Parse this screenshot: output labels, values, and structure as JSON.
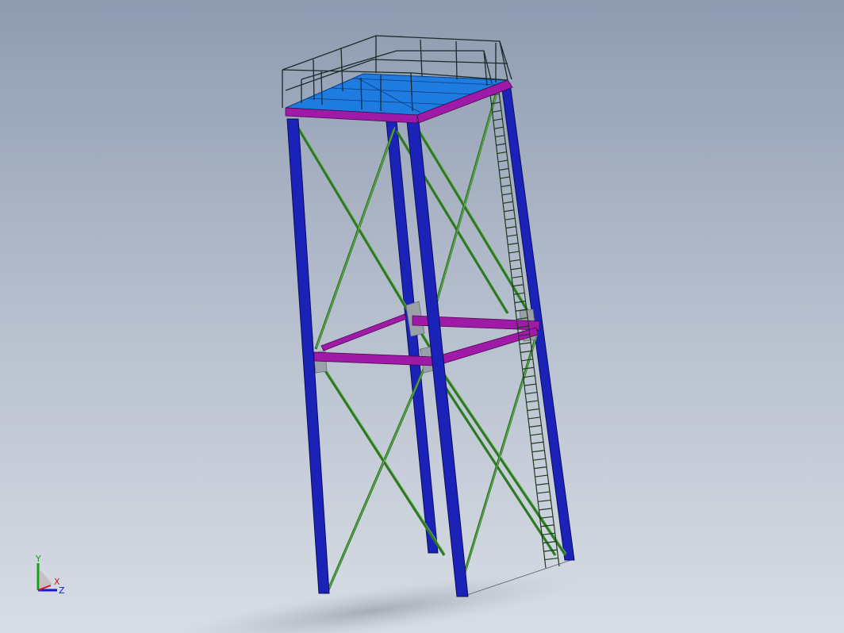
{
  "viewport": {
    "background_top": "#8e9bb0",
    "background_bottom": "#d8dde5"
  },
  "model": {
    "colors": {
      "column": "#1a22b8",
      "column_edge": "#0a0f5a",
      "beam": "#a01aa8",
      "bracing": "#2e7a22",
      "deck": "#1e7be0",
      "railing": "#1a2a2a",
      "ladder": "#1e3a20",
      "gusset": "#9aa0a8"
    }
  },
  "triad": {
    "y_label": "Y",
    "x_label": "X",
    "z_label": "Z",
    "colors": {
      "y": "#18a018",
      "x": "#d01818",
      "z": "#1818d0"
    }
  }
}
